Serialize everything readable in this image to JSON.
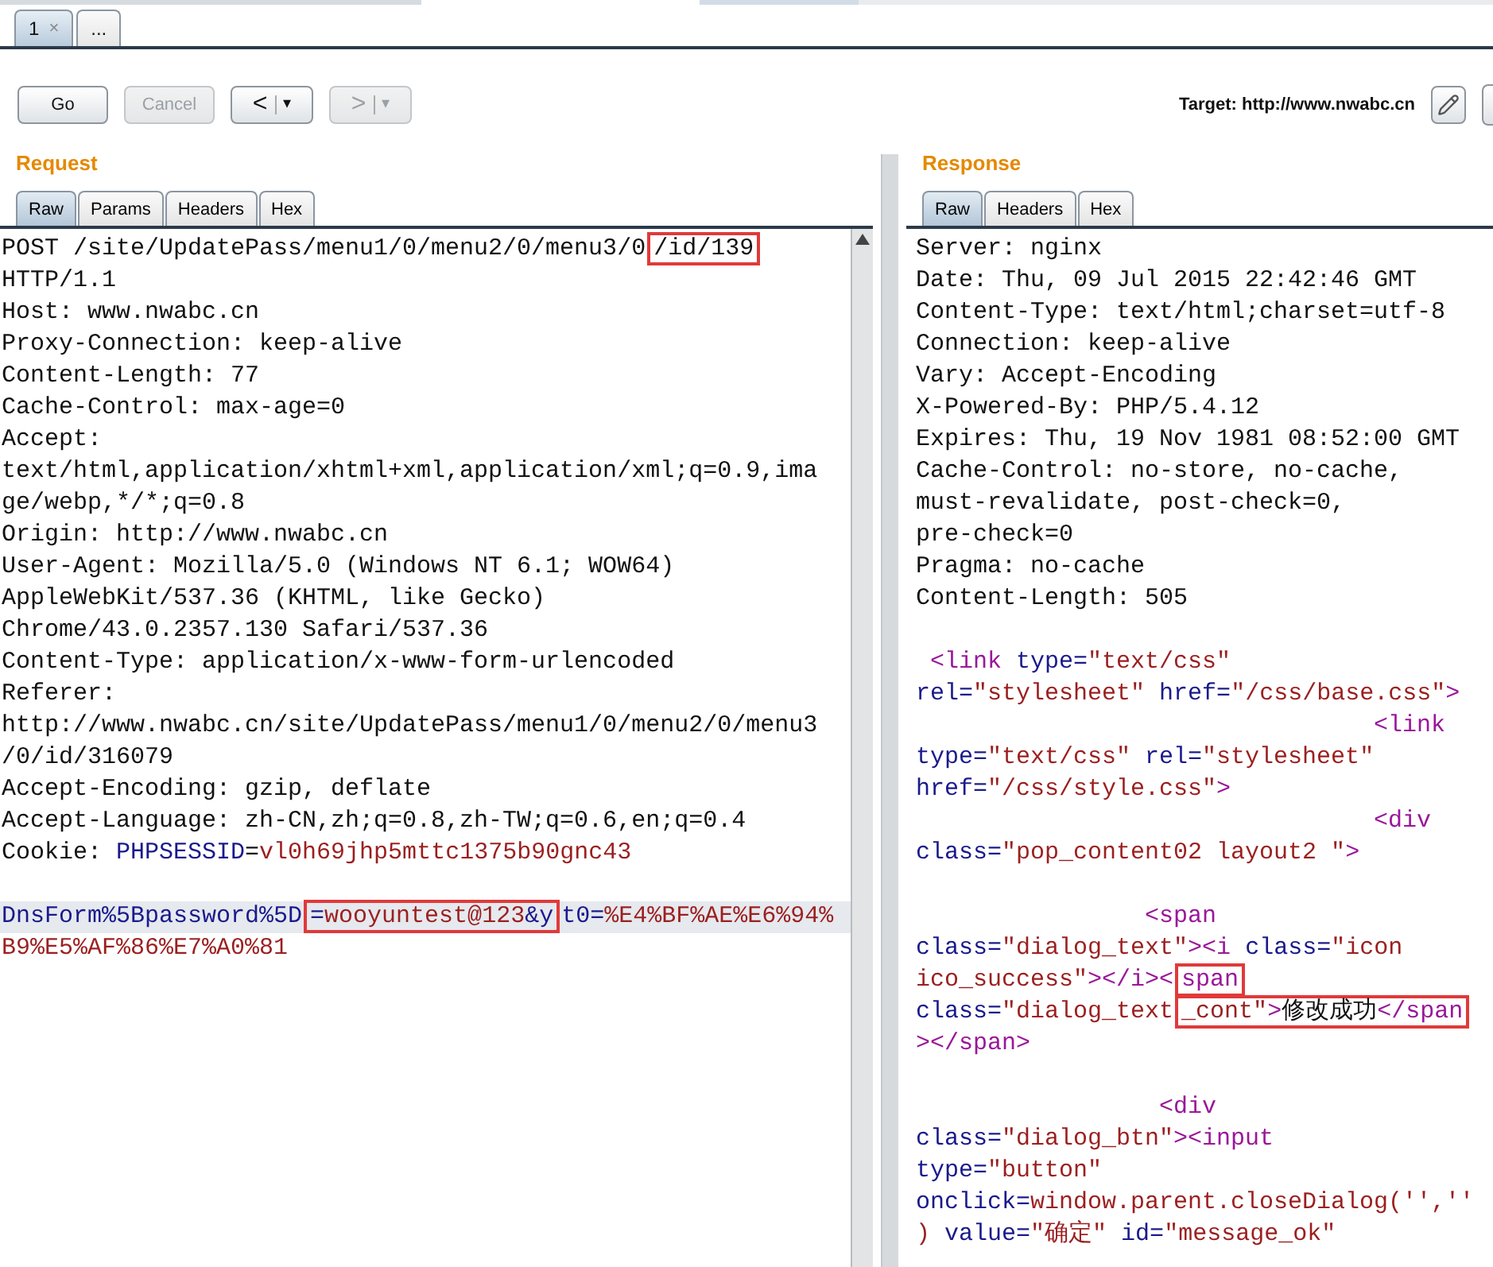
{
  "tabs": [
    {
      "label": "1",
      "close": "×",
      "selected": true
    },
    {
      "label": "...",
      "selected": false
    }
  ],
  "toolbar": {
    "buttons": [
      {
        "kind": "text",
        "label": "Go",
        "disabled": false
      },
      {
        "kind": "text",
        "label": "Cancel",
        "disabled": true
      },
      {
        "kind": "nav",
        "label": "<",
        "dropdown": "▾",
        "disabled": false
      },
      {
        "kind": "nav",
        "label": ">",
        "dropdown": "▾",
        "disabled": true
      }
    ],
    "target": "Target: http://www.nwabc.cn"
  },
  "request": {
    "title": "Request",
    "tabs": [
      {
        "label": "Raw",
        "selected": true
      },
      {
        "label": "Params",
        "selected": false
      },
      {
        "label": "Headers",
        "selected": false
      },
      {
        "label": "Hex",
        "selected": false
      }
    ],
    "lines": [
      {
        "kind": "text",
        "current": false,
        "segments": [
          {
            "kind": "plain",
            "text": "POST /site/UpdatePass/menu1/0/menu2/0/menu3/0"
          },
          {
            "kind": "plain",
            "text": "/id/139",
            "boxed": true
          }
        ]
      },
      {
        "kind": "text",
        "current": false,
        "segments": [
          {
            "kind": "plain",
            "text": "HTTP/1.1"
          }
        ]
      },
      {
        "kind": "text",
        "current": false,
        "segments": [
          {
            "kind": "plain",
            "text": "Host: www.nwabc.cn"
          }
        ]
      },
      {
        "kind": "text",
        "current": false,
        "segments": [
          {
            "kind": "plain",
            "text": "Proxy-Connection: keep-alive"
          }
        ]
      },
      {
        "kind": "text",
        "current": false,
        "segments": [
          {
            "kind": "plain",
            "text": "Content-Length: 77"
          }
        ]
      },
      {
        "kind": "text",
        "current": false,
        "segments": [
          {
            "kind": "plain",
            "text": "Cache-Control: max-age=0"
          }
        ]
      },
      {
        "kind": "text",
        "current": false,
        "segments": [
          {
            "kind": "plain",
            "text": "Accept:"
          }
        ]
      },
      {
        "kind": "text",
        "current": false,
        "segments": [
          {
            "kind": "plain",
            "text": "text/html,application/xhtml+xml,application/xml;q=0.9,ima"
          }
        ]
      },
      {
        "kind": "text",
        "current": false,
        "segments": [
          {
            "kind": "plain",
            "text": "ge/webp,*/*;q=0.8"
          }
        ]
      },
      {
        "kind": "text",
        "current": false,
        "segments": [
          {
            "kind": "plain",
            "text": "Origin: http://www.nwabc.cn"
          }
        ]
      },
      {
        "kind": "text",
        "current": false,
        "segments": [
          {
            "kind": "plain",
            "text": "User-Agent: Mozilla/5.0 (Windows NT 6.1; WOW64)"
          }
        ]
      },
      {
        "kind": "text",
        "current": false,
        "segments": [
          {
            "kind": "plain",
            "text": "AppleWebKit/537.36 (KHTML, like Gecko)"
          }
        ]
      },
      {
        "kind": "text",
        "current": false,
        "segments": [
          {
            "kind": "plain",
            "text": "Chrome/43.0.2357.130 Safari/537.36"
          }
        ]
      },
      {
        "kind": "text",
        "current": false,
        "segments": [
          {
            "kind": "plain",
            "text": "Content-Type: application/x-www-form-urlencoded"
          }
        ]
      },
      {
        "kind": "text",
        "current": false,
        "segments": [
          {
            "kind": "plain",
            "text": "Referer:"
          }
        ]
      },
      {
        "kind": "text",
        "current": false,
        "segments": [
          {
            "kind": "plain",
            "text": "http://www.nwabc.cn/site/UpdatePass/menu1/0/menu2/0/menu3"
          }
        ]
      },
      {
        "kind": "text",
        "current": false,
        "segments": [
          {
            "kind": "plain",
            "text": "/0/id/316079"
          }
        ]
      },
      {
        "kind": "text",
        "current": false,
        "segments": [
          {
            "kind": "plain",
            "text": "Accept-Encoding: gzip, deflate"
          }
        ]
      },
      {
        "kind": "text",
        "current": false,
        "segments": [
          {
            "kind": "plain",
            "text": "Accept-Language: zh-CN,zh;q=0.8,zh-TW;q=0.6,en;q=0.4"
          }
        ]
      },
      {
        "kind": "text",
        "current": false,
        "segments": [
          {
            "kind": "plain",
            "text": "Cookie: "
          },
          {
            "kind": "attr",
            "text": "PHPSESSID"
          },
          {
            "kind": "plain",
            "text": "="
          },
          {
            "kind": "value",
            "text": "vl0h69jhp5mttc1375b90gnc43"
          }
        ]
      },
      {
        "kind": "blank",
        "current": false
      },
      {
        "kind": "text",
        "current": true,
        "segments": [
          {
            "kind": "attr",
            "text": "DnsForm%5Bpassword%5D"
          },
          {
            "kind": "attr",
            "text": "=",
            "boxed": true
          },
          {
            "kind": "value",
            "text": "wooyuntest@123",
            "boxed": true
          },
          {
            "kind": "attr",
            "text": "&y",
            "boxed": true
          },
          {
            "kind": "attr",
            "text": "t0="
          },
          {
            "kind": "value",
            "text": "%E4%BF%AE%E6%94%"
          }
        ]
      },
      {
        "kind": "text",
        "current": false,
        "segments": [
          {
            "kind": "value",
            "text": "B9%E5%AF%86%E7%A0%81"
          }
        ]
      }
    ]
  },
  "response": {
    "title": "Response",
    "tabs": [
      {
        "label": "Raw",
        "selected": true
      },
      {
        "label": "Headers",
        "selected": false
      },
      {
        "label": "Hex",
        "selected": false
      }
    ],
    "lines": [
      {
        "kind": "text",
        "current": false,
        "segments": [
          {
            "kind": "plain",
            "text": "Server: nginx"
          }
        ]
      },
      {
        "kind": "text",
        "current": false,
        "segments": [
          {
            "kind": "plain",
            "text": "Date: Thu, 09 Jul 2015 22:42:46 GMT"
          }
        ]
      },
      {
        "kind": "text",
        "current": false,
        "segments": [
          {
            "kind": "plain",
            "text": "Content-Type: text/html;charset=utf-8"
          }
        ]
      },
      {
        "kind": "text",
        "current": false,
        "segments": [
          {
            "kind": "plain",
            "text": "Connection: keep-alive"
          }
        ]
      },
      {
        "kind": "text",
        "current": false,
        "segments": [
          {
            "kind": "plain",
            "text": "Vary: Accept-Encoding"
          }
        ]
      },
      {
        "kind": "text",
        "current": false,
        "segments": [
          {
            "kind": "plain",
            "text": "X-Powered-By: PHP/5.4.12"
          }
        ]
      },
      {
        "kind": "text",
        "current": false,
        "segments": [
          {
            "kind": "plain",
            "text": "Expires: Thu, 19 Nov 1981 08:52:00 GMT"
          }
        ]
      },
      {
        "kind": "text",
        "current": false,
        "segments": [
          {
            "kind": "plain",
            "text": "Cache-Control: no-store, no-cache,"
          }
        ]
      },
      {
        "kind": "text",
        "current": false,
        "segments": [
          {
            "kind": "plain",
            "text": "must-revalidate, post-check=0,"
          }
        ]
      },
      {
        "kind": "text",
        "current": false,
        "segments": [
          {
            "kind": "plain",
            "text": "pre-check=0"
          }
        ]
      },
      {
        "kind": "text",
        "current": false,
        "segments": [
          {
            "kind": "plain",
            "text": "Pragma: no-cache"
          }
        ]
      },
      {
        "kind": "text",
        "current": false,
        "segments": [
          {
            "kind": "plain",
            "text": "Content-Length: 505"
          }
        ]
      },
      {
        "kind": "blank",
        "current": false
      },
      {
        "kind": "text",
        "current": false,
        "segments": [
          {
            "kind": "tag",
            "text": " <link"
          },
          {
            "kind": "attr",
            "text": " type="
          },
          {
            "kind": "value",
            "text": "\"text/css\""
          }
        ]
      },
      {
        "kind": "text",
        "current": false,
        "segments": [
          {
            "kind": "attr",
            "text": "rel="
          },
          {
            "kind": "value",
            "text": "\"stylesheet\""
          },
          {
            "kind": "attr",
            "text": " href="
          },
          {
            "kind": "value",
            "text": "\"/css/base.css\""
          },
          {
            "kind": "tag",
            "text": ">"
          }
        ]
      },
      {
        "kind": "text",
        "current": false,
        "segments": [
          {
            "kind": "tag",
            "text": "                                <link"
          }
        ]
      },
      {
        "kind": "text",
        "current": false,
        "segments": [
          {
            "kind": "attr",
            "text": "type="
          },
          {
            "kind": "value",
            "text": "\"text/css\""
          },
          {
            "kind": "attr",
            "text": " rel="
          },
          {
            "kind": "value",
            "text": "\"stylesheet\""
          }
        ]
      },
      {
        "kind": "text",
        "current": false,
        "segments": [
          {
            "kind": "attr",
            "text": "href="
          },
          {
            "kind": "value",
            "text": "\"/css/style.css\""
          },
          {
            "kind": "tag",
            "text": ">"
          }
        ]
      },
      {
        "kind": "text",
        "current": false,
        "segments": [
          {
            "kind": "tag",
            "text": "                                <div"
          }
        ]
      },
      {
        "kind": "text",
        "current": false,
        "segments": [
          {
            "kind": "attr",
            "text": "class="
          },
          {
            "kind": "value",
            "text": "\"pop_content02 layout2 \""
          },
          {
            "kind": "tag",
            "text": ">"
          }
        ]
      },
      {
        "kind": "blank",
        "current": false
      },
      {
        "kind": "text",
        "current": false,
        "segments": [
          {
            "kind": "tag",
            "text": "                <span"
          }
        ]
      },
      {
        "kind": "text",
        "current": false,
        "segments": [
          {
            "kind": "attr",
            "text": "class="
          },
          {
            "kind": "value",
            "text": "\"dialog_text\""
          },
          {
            "kind": "tag",
            "text": "><i"
          },
          {
            "kind": "attr",
            "text": " class="
          },
          {
            "kind": "value",
            "text": "\"icon"
          }
        ]
      },
      {
        "kind": "text",
        "current": false,
        "segments": [
          {
            "kind": "value",
            "text": "ico_success\""
          },
          {
            "kind": "tag",
            "text": "></i><"
          },
          {
            "kind": "tag",
            "text": "span",
            "boxed": true
          }
        ]
      },
      {
        "kind": "text",
        "current": false,
        "segments": [
          {
            "kind": "attr",
            "text": "class="
          },
          {
            "kind": "value",
            "text": "\"dialog_text"
          },
          {
            "kind": "value",
            "text": "_cont\"",
            "boxed": true
          },
          {
            "kind": "tag",
            "text": ">",
            "boxed": true
          },
          {
            "kind": "plain",
            "text": "修改成功",
            "boxed": true
          },
          {
            "kind": "tag",
            "text": "</span",
            "boxed": true
          }
        ]
      },
      {
        "kind": "text",
        "current": false,
        "segments": [
          {
            "kind": "tag",
            "text": "></span>"
          }
        ]
      },
      {
        "kind": "blank",
        "current": false
      },
      {
        "kind": "text",
        "current": false,
        "segments": [
          {
            "kind": "tag",
            "text": "                 <div"
          }
        ]
      },
      {
        "kind": "text",
        "current": false,
        "segments": [
          {
            "kind": "attr",
            "text": "class="
          },
          {
            "kind": "value",
            "text": "\"dialog_btn\""
          },
          {
            "kind": "tag",
            "text": "><input"
          }
        ]
      },
      {
        "kind": "text",
        "current": false,
        "segments": [
          {
            "kind": "attr",
            "text": "type="
          },
          {
            "kind": "value",
            "text": "\"button\""
          }
        ]
      },
      {
        "kind": "text",
        "current": false,
        "segments": [
          {
            "kind": "attr",
            "text": "onclick="
          },
          {
            "kind": "value",
            "text": "window.parent.closeDialog('',''"
          }
        ]
      },
      {
        "kind": "text",
        "current": false,
        "segments": [
          {
            "kind": "value",
            "text": ")"
          },
          {
            "kind": "attr",
            "text": " value="
          },
          {
            "kind": "value",
            "text": "\"确定\""
          },
          {
            "kind": "attr",
            "text": " id="
          },
          {
            "kind": "value",
            "text": "\"message_ok\""
          }
        ]
      }
    ]
  }
}
